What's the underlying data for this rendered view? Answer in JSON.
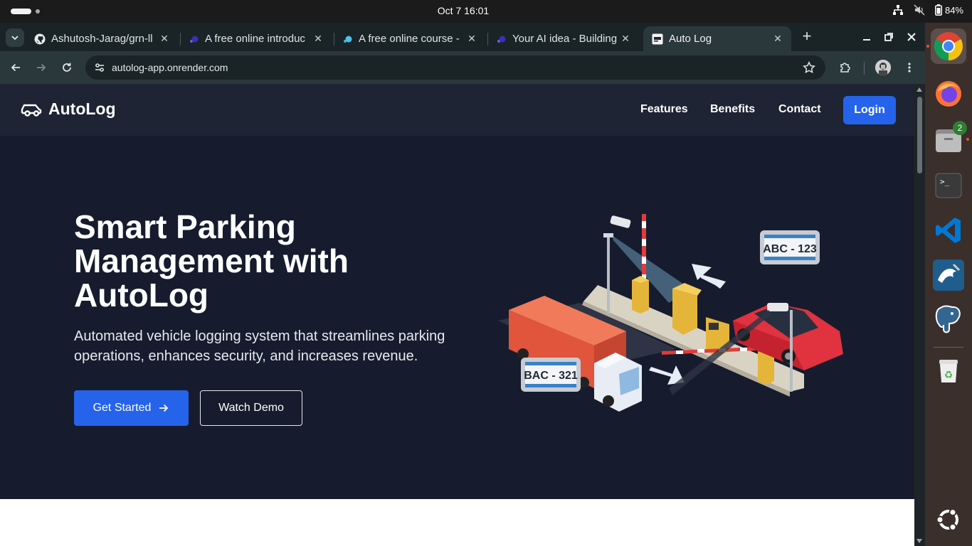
{
  "system": {
    "clock": "Oct 7  16:01",
    "battery": "84%"
  },
  "browser": {
    "tabs": [
      {
        "title": "Ashutosh-Jarag/grn-ll"
      },
      {
        "title": "A free online introduc"
      },
      {
        "title": "A free online course -"
      },
      {
        "title": "Your AI idea - Building"
      },
      {
        "title": "Auto Log",
        "active": true
      }
    ],
    "new_tab": "+",
    "url": "autolog-app.onrender.com"
  },
  "page": {
    "brand": "AutoLog",
    "nav": {
      "features": "Features",
      "benefits": "Benefits",
      "contact": "Contact",
      "login": "Login"
    },
    "hero": {
      "title": "Smart Parking Management with AutoLog",
      "subtitle": "Automated vehicle logging system that streamlines parking operations, enhances security, and increases revenue.",
      "primary_cta": "Get Started",
      "secondary_cta": "Watch Demo"
    },
    "illustration": {
      "plate_top": "ABC - 123",
      "plate_bottom": "BAC - 321"
    },
    "colors": {
      "accent": "#2563eb",
      "nav_bg": "#1e2433",
      "hero_bg": "#161c2d"
    }
  },
  "dock": {
    "files_badge": "2",
    "items": [
      "chrome-icon",
      "firefox-icon",
      "files-icon",
      "terminal-icon",
      "vscode-icon",
      "mysql-workbench-icon",
      "postgres-icon",
      "trash-icon",
      "show-apps-icon"
    ]
  }
}
